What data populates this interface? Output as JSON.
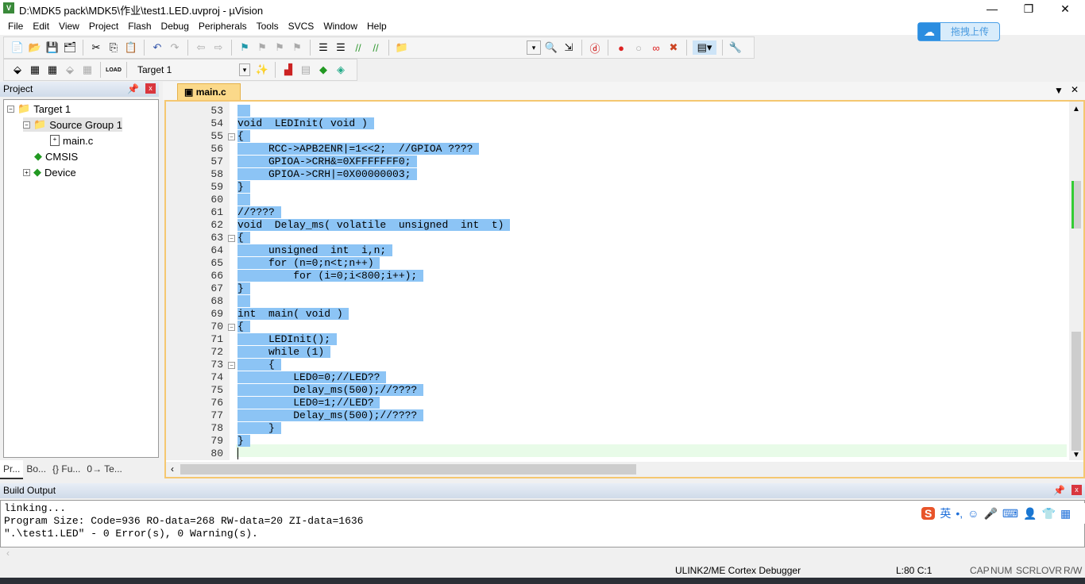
{
  "window": {
    "title": "D:\\MDK5 pack\\MDK5\\作业\\test1.LED.uvproj - µVision",
    "app_icon": "uvision-logo"
  },
  "menu": [
    "File",
    "Edit",
    "View",
    "Project",
    "Flash",
    "Debug",
    "Peripherals",
    "Tools",
    "SVCS",
    "Window",
    "Help"
  ],
  "toolbar": {
    "target": "Target 1",
    "load_label": "LOAD"
  },
  "baidu": {
    "label": "拖拽上传"
  },
  "project": {
    "title": "Project",
    "tree": [
      {
        "label": "Target 1",
        "icon": "target-folder-icon"
      },
      {
        "label": "Source Group 1",
        "icon": "folder-icon"
      },
      {
        "label": "main.c",
        "icon": "c-file-icon"
      },
      {
        "label": "CMSIS",
        "icon": "component-icon"
      },
      {
        "label": "Device",
        "icon": "component-icon"
      }
    ],
    "tabs": [
      "Pr...",
      "Bo...",
      "{} Fu...",
      "0→ Te..."
    ]
  },
  "editor": {
    "tab": "main.c",
    "selection_color": "#8cc4f5",
    "lines": [
      {
        "n": "53",
        "t": ""
      },
      {
        "n": "54",
        "t": "void  LEDInit( void )"
      },
      {
        "n": "55",
        "t": "{"
      },
      {
        "n": "56",
        "t": "     RCC->APB2ENR|=1<<2;  //GPIOA ????"
      },
      {
        "n": "57",
        "t": "     GPIOA->CRH&=0XFFFFFFF0;"
      },
      {
        "n": "58",
        "t": "     GPIOA->CRH|=0X00000003;"
      },
      {
        "n": "59",
        "t": "}"
      },
      {
        "n": "60",
        "t": ""
      },
      {
        "n": "61",
        "t": "//????"
      },
      {
        "n": "62",
        "t": "void  Delay_ms( volatile  unsigned  int  t)"
      },
      {
        "n": "63",
        "t": "{"
      },
      {
        "n": "64",
        "t": "     unsigned  int  i,n;"
      },
      {
        "n": "65",
        "t": "     for (n=0;n<t;n++)"
      },
      {
        "n": "66",
        "t": "         for (i=0;i<800;i++);"
      },
      {
        "n": "67",
        "t": "}"
      },
      {
        "n": "68",
        "t": ""
      },
      {
        "n": "69",
        "t": "int  main( void )"
      },
      {
        "n": "70",
        "t": "{"
      },
      {
        "n": "71",
        "t": "     LEDInit();"
      },
      {
        "n": "72",
        "t": "     while (1)"
      },
      {
        "n": "73",
        "t": "     {"
      },
      {
        "n": "74",
        "t": "         LED0=0;//LED??"
      },
      {
        "n": "75",
        "t": "         Delay_ms(500);//????"
      },
      {
        "n": "76",
        "t": "         LED0=1;//LED?"
      },
      {
        "n": "77",
        "t": "         Delay_ms(500);//????"
      },
      {
        "n": "78",
        "t": "     }"
      },
      {
        "n": "79",
        "t": "}"
      },
      {
        "n": "80",
        "t": ""
      }
    ]
  },
  "build": {
    "title": "Build Output",
    "lines": [
      "linking...",
      "Program Size: Code=936 RO-data=268 RW-data=20 ZI-data=1636",
      "\".\\test1.LED\" - 0 Error(s), 0 Warning(s)."
    ]
  },
  "ime": {
    "lang": "英"
  },
  "status": {
    "debugger": "ULINK2/ME Cortex Debugger",
    "position": "L:80 C:1",
    "flags": [
      "CAP",
      "NUM",
      "SCRL",
      "OVR",
      "R/W"
    ]
  }
}
